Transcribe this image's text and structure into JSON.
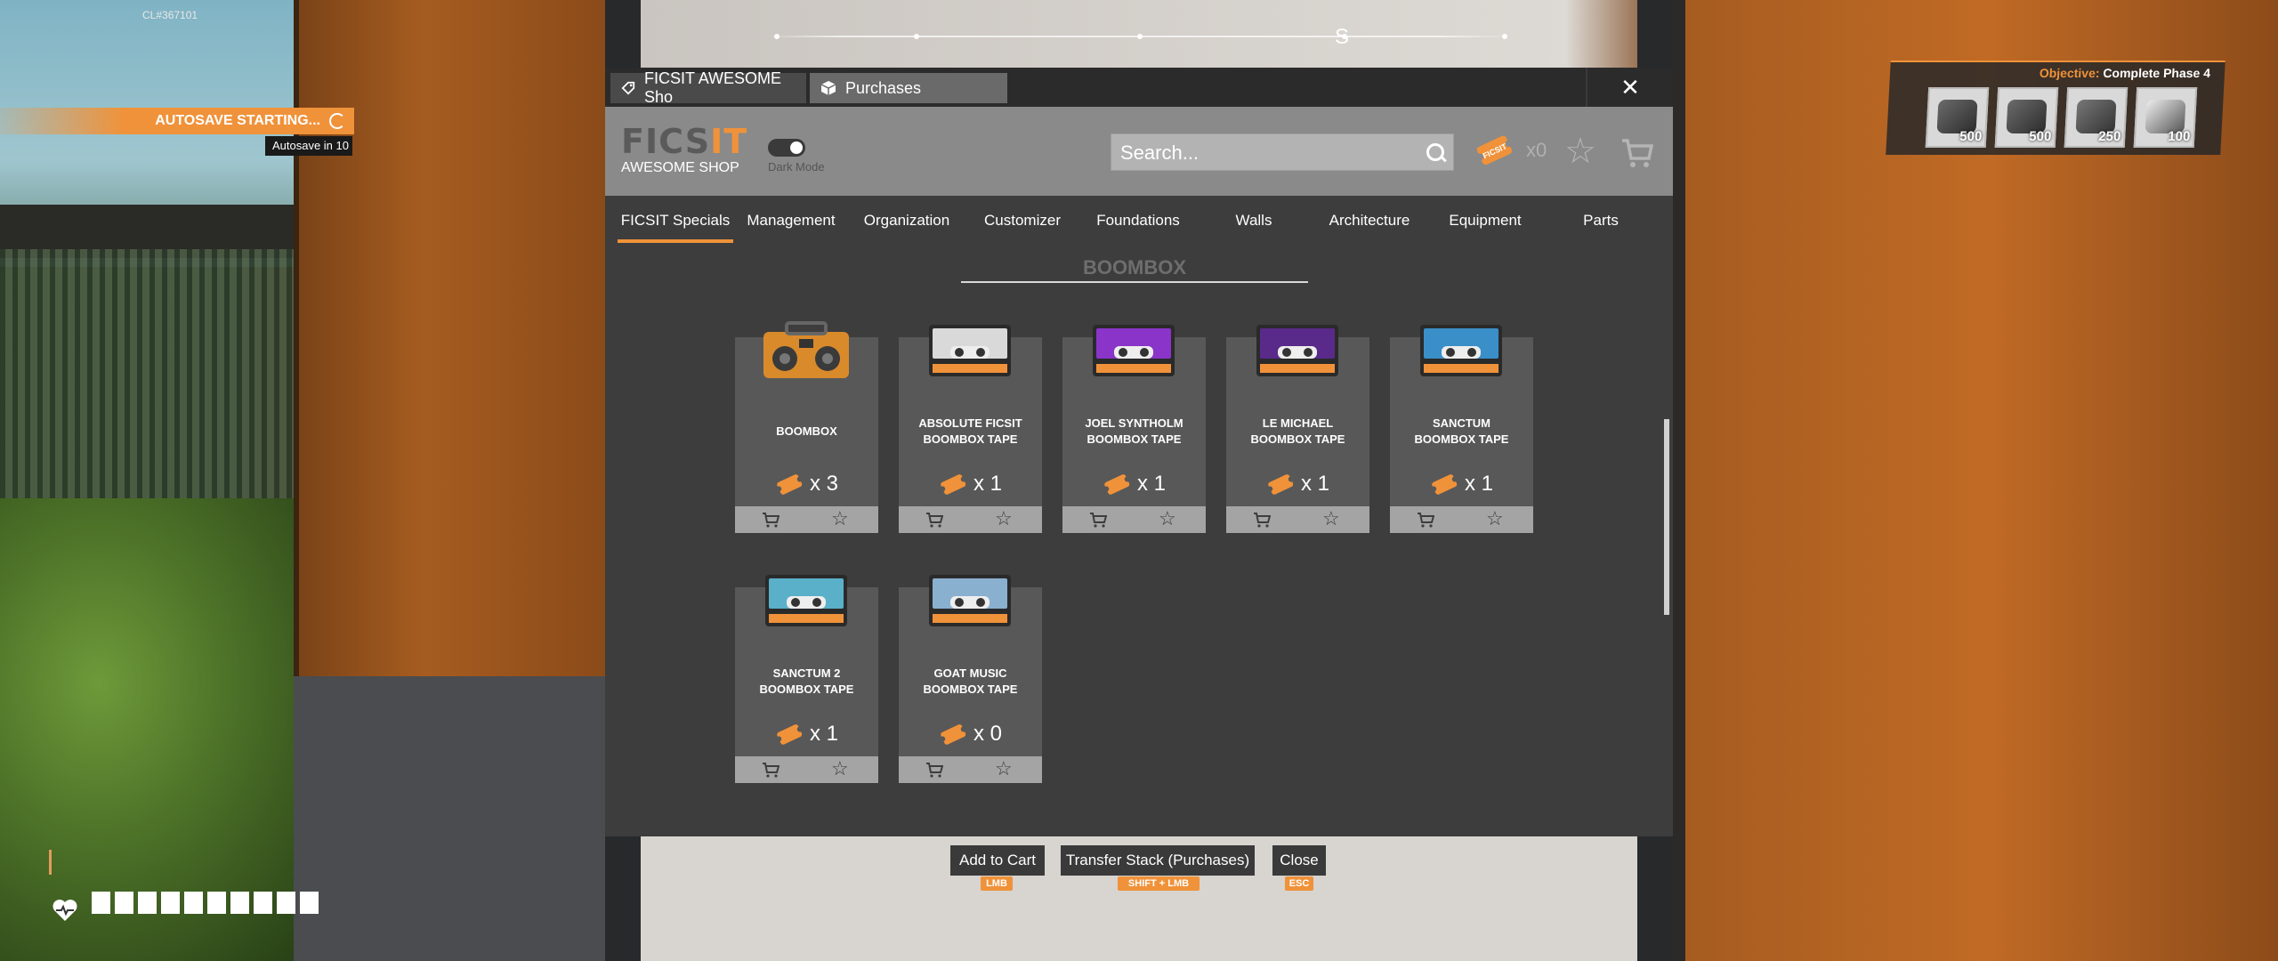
{
  "hud": {
    "build_id": "CL#367101",
    "autosave_title": "AUTOSAVE STARTING...",
    "autosave_sub": "Autosave in 10",
    "compass_letter": "S",
    "health_segments": 10,
    "objective": {
      "key": "Objective:",
      "value": "Complete Phase 4",
      "items": [
        {
          "icon": "motor-part-icon",
          "count": "500"
        },
        {
          "icon": "smart-plating-icon",
          "count": "500"
        },
        {
          "icon": "heavy-frame-icon",
          "count": "250"
        },
        {
          "icon": "computer-part-icon",
          "count": "100"
        }
      ]
    }
  },
  "window": {
    "tabs": [
      {
        "label": "FICSIT AWESOME Sho",
        "icon": "coupon-tag-icon",
        "active": true
      },
      {
        "label": "Purchases",
        "icon": "box-icon",
        "active": false
      }
    ],
    "close": "✕"
  },
  "header": {
    "logo_text": "FICSIT",
    "logo_sub": "AWESOME SHOP",
    "dark_mode_label": "Dark Mode",
    "dark_mode_on": true,
    "search_placeholder": "Search...",
    "coupon_count": "x0"
  },
  "nav": [
    {
      "label": "FICSIT Specials",
      "active": true
    },
    {
      "label": "Management"
    },
    {
      "label": "Organization"
    },
    {
      "label": "Customizer"
    },
    {
      "label": "Foundations"
    },
    {
      "label": "Walls"
    },
    {
      "label": "Architecture"
    },
    {
      "label": "Equipment"
    },
    {
      "label": "Parts"
    }
  ],
  "section": {
    "title": "BOOMBOX"
  },
  "products": [
    {
      "name_l1": "BOOMBOX",
      "name_l2": "",
      "price": "x 3",
      "icon": "boombox-icon",
      "color": "#d98a2b"
    },
    {
      "name_l1": "ABSOLUTE FICSIT",
      "name_l2": "BOOMBOX TAPE",
      "price": "x 1",
      "icon": "tape-icon",
      "color": "#d9d9d9"
    },
    {
      "name_l1": "JOEL SYNTHOLM",
      "name_l2": "BOOMBOX TAPE",
      "price": "x 1",
      "icon": "tape-icon",
      "color": "#8a34c9"
    },
    {
      "name_l1": "LE MICHAEL",
      "name_l2": "BOOMBOX TAPE",
      "price": "x 1",
      "icon": "tape-icon",
      "color": "#5a2a8a"
    },
    {
      "name_l1": "SANCTUM",
      "name_l2": "BOOMBOX TAPE",
      "price": "x 1",
      "icon": "tape-icon",
      "color": "#3a8fc9"
    },
    {
      "name_l1": "SANCTUM 2",
      "name_l2": "BOOMBOX TAPE",
      "price": "x 1",
      "icon": "tape-icon",
      "color": "#5ab0c9"
    },
    {
      "name_l1": "GOAT MUSIC",
      "name_l2": "BOOMBOX TAPE",
      "price": "x 0",
      "icon": "tape-icon",
      "color": "#8ab0d0"
    }
  ],
  "actions": [
    {
      "label": "Add to Cart",
      "key": "LMB"
    },
    {
      "label": "Transfer Stack (Purchases)",
      "key": "SHIFT + LMB"
    },
    {
      "label": "Close",
      "key": "ESC"
    }
  ]
}
